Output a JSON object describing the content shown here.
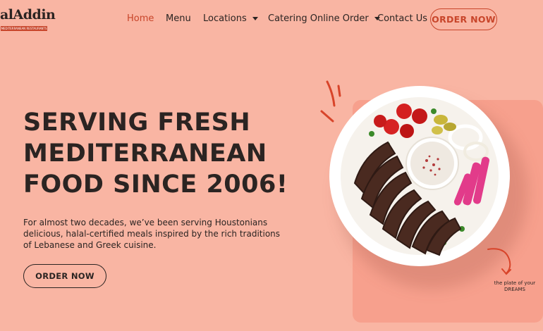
{
  "header": {
    "logo": {
      "word": "alAddin",
      "tagline": "MEDITERRANEAN RESTAURANTS"
    },
    "nav": [
      {
        "label": "Home",
        "active": true
      },
      {
        "label": "Menu",
        "active": false
      },
      {
        "label": "Locations",
        "active": false,
        "dropdown": true
      },
      {
        "label": "Catering Online Order",
        "active": false,
        "dropdown": true
      },
      {
        "label": "Contact Us",
        "active": false
      }
    ],
    "order_button": "ORDER NOW"
  },
  "hero": {
    "title": "SERVING FRESH\nMEDITERRANEAN\nFOOD SINCE 2006!",
    "text": "For almost two decades, we’ve been serving Houstonians delicious, halal-certified meals inspired by the rich traditions of Lebanese and Greek cuisine.",
    "order_button": "ORDER NOW"
  },
  "image_tagline": "the plate of your\nDREAMS",
  "colors": {
    "background": "#f9b5a3",
    "accent": "#c8452a",
    "card": "#f7a08d",
    "text": "#2b2422"
  }
}
